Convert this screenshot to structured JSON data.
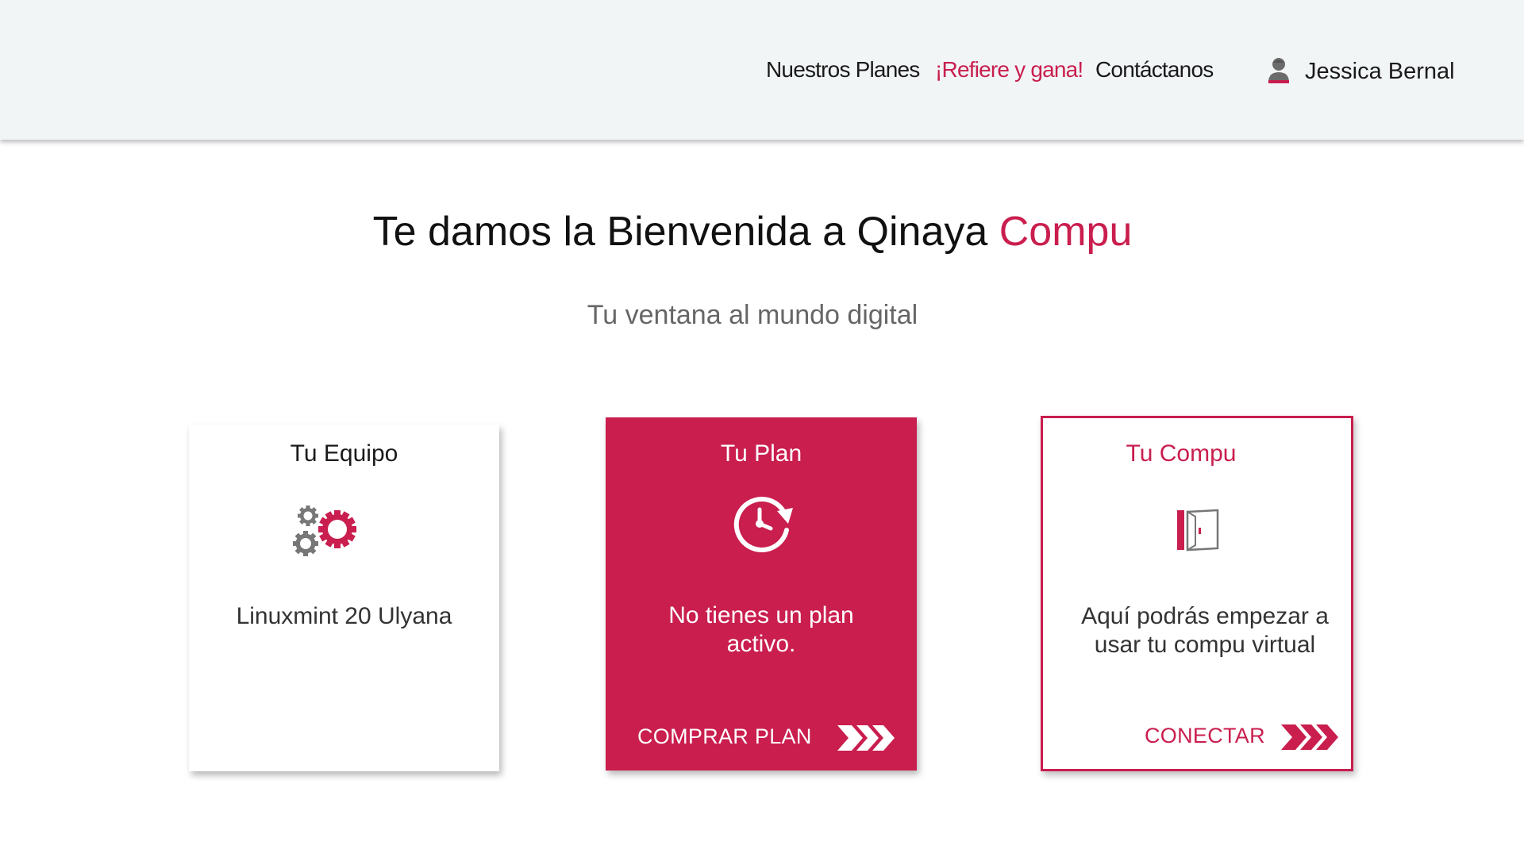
{
  "header": {
    "nav": {
      "planes": "Nuestros Planes",
      "refiere": "¡Refiere y gana!",
      "contacto": "Contáctanos"
    },
    "user": {
      "name": "Jessica Bernal"
    }
  },
  "hero": {
    "title_main": "Te damos la Bienvenida a Qinaya ",
    "title_accent": "Compu",
    "subtitle": "Tu ventana al mundo digital"
  },
  "cards": {
    "equipo": {
      "title": "Tu Equipo",
      "text": "Linuxmint 20 Ulyana"
    },
    "plan": {
      "title": "Tu Plan",
      "text": "No tienes un plan activo.",
      "action": "COMPRAR PLAN"
    },
    "compu": {
      "title": "Tu Compu",
      "text": "Aquí podrás empezar a usar tu compu virtual",
      "action": "CONECTAR"
    }
  },
  "colors": {
    "accent": "#c91e4e",
    "header_bg": "#f2f5f6",
    "text": "#1a1a1a",
    "muted": "#666666"
  },
  "icons": {
    "user": "user-icon",
    "equipo": "gears-icon",
    "plan": "clock-refresh-icon",
    "compu": "door-icon",
    "action": "triple-chevron-icon"
  }
}
